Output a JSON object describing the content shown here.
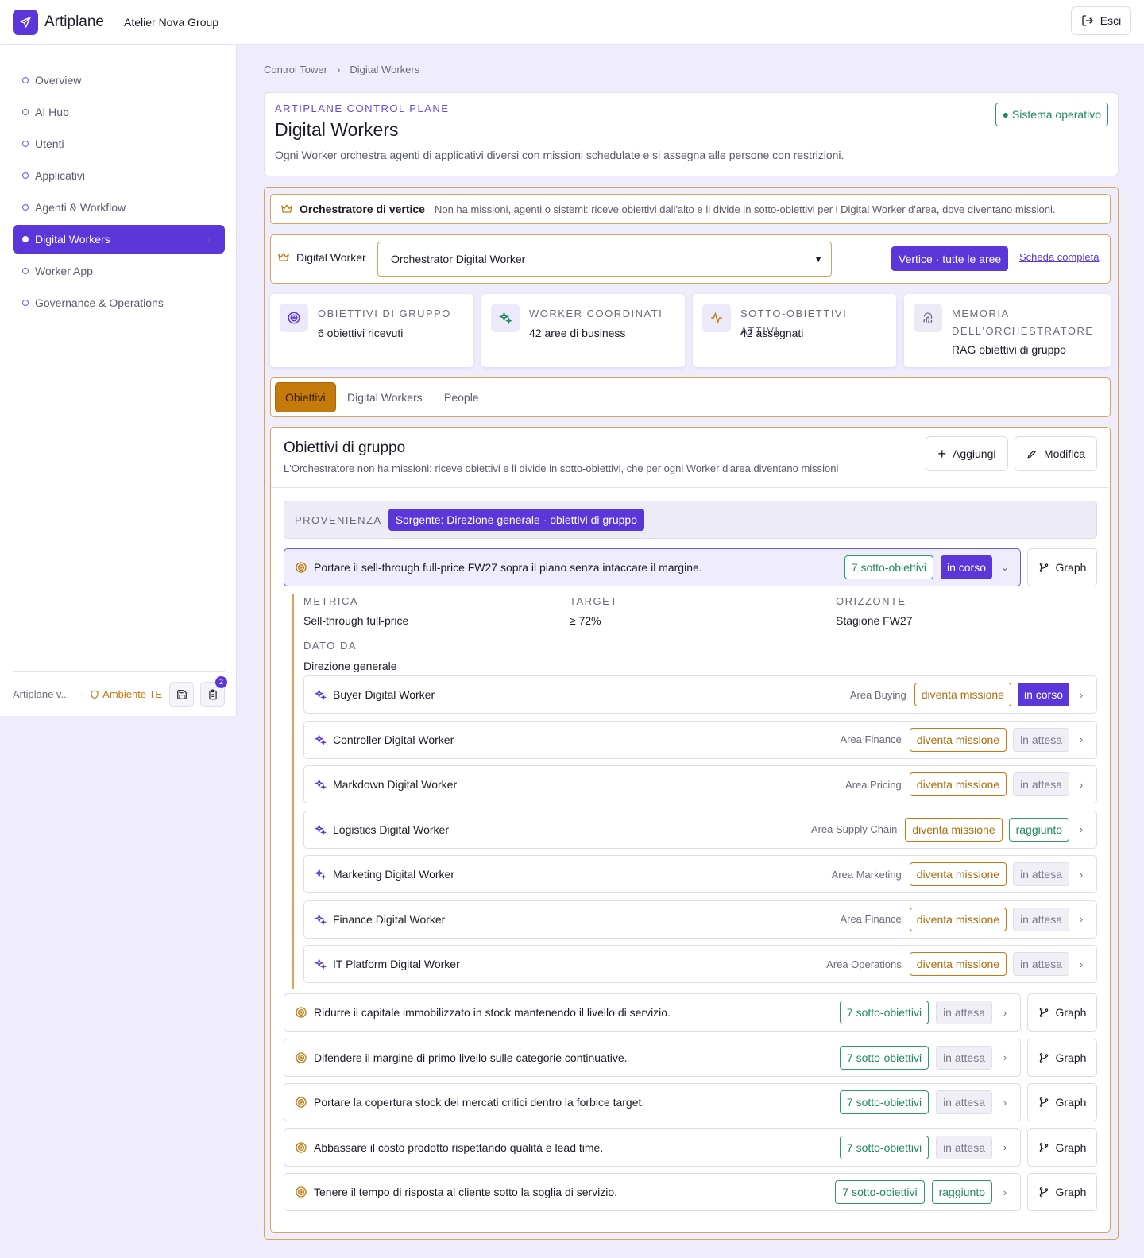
{
  "header": {
    "brand": "Artiplane",
    "org": "Atelier Nova Group",
    "exit_label": "Esci"
  },
  "sidebar": {
    "items": [
      {
        "label": "Overview",
        "active": false
      },
      {
        "label": "AI Hub",
        "active": false
      },
      {
        "label": "Utenti",
        "active": false
      },
      {
        "label": "Applicativi",
        "active": false
      },
      {
        "label": "Agenti & Workflow",
        "active": false
      },
      {
        "label": "Digital Workers",
        "active": true
      },
      {
        "label": "Worker App",
        "active": false
      },
      {
        "label": "Governance & Operations",
        "active": false
      }
    ],
    "footer": {
      "version": "Artiplane v...",
      "env": "Ambiente TE",
      "badge_count": "2"
    }
  },
  "breadcrumb": [
    "Control Tower",
    "Digital Workers"
  ],
  "hero": {
    "eyebrow": "ARTIPLANE CONTROL PLANE",
    "title": "Digital Workers",
    "subtitle": "Ogni Worker orchestra agenti di applicativi diversi con missioni schedulate e si assegna alle persone con restrizioni.",
    "status": "● Sistema operativo"
  },
  "orchestrator": {
    "title": "Orchestratore di vertice",
    "description": "Non ha missioni, agenti o sistemi: riceve obiettivi dall'alto e li divide in sotto-obiettivi per i Digital Worker d'area, dove diventano missioni."
  },
  "worker_select": {
    "label": "Digital Worker",
    "value": "Orchestrator Digital Worker",
    "vertex_button": "Vertice · tutte le aree",
    "full_card_link": "Scheda completa"
  },
  "kpis": [
    {
      "label": "OBIETTIVI DI GRUPPO",
      "value": "6 obiettivi ricevuti",
      "icon": "target-icon"
    },
    {
      "label": "WORKER COORDINATI",
      "value": "42 aree di business",
      "icon": "sparkle-icon"
    },
    {
      "label": "SOTTO-OBIETTIVI ATTIVI",
      "value": "42 assegnati",
      "icon": "activity-icon"
    },
    {
      "label": "MEMORIA DELL'ORCHESTRATORE",
      "value": "RAG obiettivi di gruppo",
      "icon": "fingerprint-icon"
    }
  ],
  "tabs": [
    "Obiettivi",
    "Digital Workers",
    "People"
  ],
  "panel": {
    "title": "Obiettivi di gruppo",
    "subtitle": "L'Orchestratore non ha missioni: riceve obiettivi e li divide in sotto-obiettivi, che per ogni Worker d'area diventano missioni",
    "add_label": "Aggiungi",
    "edit_label": "Modifica",
    "provenance_label": "PROVENIENZA",
    "provenance_value": "Sorgente: Direzione generale · obiettivi di gruppo",
    "graph_label": "Graph",
    "expanded_goal": {
      "text": "Portare il sell-through full-price FW27 sopra il piano senza intaccare il margine.",
      "sub_count": "7 sotto-obiettivi",
      "status": "in corso",
      "metric_label": "METRICA",
      "metric_value": "Sell-through full-price",
      "target_label": "TARGET",
      "target_value": "≥ 72%",
      "horizon_label": "ORIZZONTE",
      "horizon_value": "Stagione FW27",
      "given_by_label": "DATO DA",
      "given_by_value": "Direzione generale",
      "mission_label": "diventa missione",
      "sub_goals": [
        {
          "name": "Buyer Digital Worker",
          "area": "Area Buying",
          "status": "in corso",
          "kind": "purple"
        },
        {
          "name": "Controller Digital Worker",
          "area": "Area Finance",
          "status": "in attesa",
          "kind": "grey"
        },
        {
          "name": "Markdown Digital Worker",
          "area": "Area Pricing",
          "status": "in attesa",
          "kind": "grey"
        },
        {
          "name": "Logistics Digital Worker",
          "area": "Area Supply Chain",
          "status": "raggiunto",
          "kind": "green"
        },
        {
          "name": "Marketing Digital Worker",
          "area": "Area Marketing",
          "status": "in attesa",
          "kind": "grey"
        },
        {
          "name": "Finance Digital Worker",
          "area": "Area Finance",
          "status": "in attesa",
          "kind": "grey"
        },
        {
          "name": "IT Platform Digital Worker",
          "area": "Area Operations",
          "status": "in attesa",
          "kind": "grey"
        }
      ]
    },
    "goals": [
      {
        "text": "Ridurre il capitale immobilizzato in stock mantenendo il livello di servizio.",
        "sub_count": "7 sotto-obiettivi",
        "status": "in attesa",
        "kind": "grey"
      },
      {
        "text": "Difendere il margine di primo livello sulle categorie continuative.",
        "sub_count": "7 sotto-obiettivi",
        "status": "in attesa",
        "kind": "grey"
      },
      {
        "text": "Portare la copertura stock dei mercati critici dentro la forbice target.",
        "sub_count": "7 sotto-obiettivi",
        "status": "in attesa",
        "kind": "grey"
      },
      {
        "text": "Abbassare il costo prodotto rispettando qualità e lead time.",
        "sub_count": "7 sotto-obiettivi",
        "status": "in attesa",
        "kind": "grey"
      },
      {
        "text": "Tenere il tempo di risposta al cliente sotto la soglia di servizio.",
        "sub_count": "7 sotto-obiettivi",
        "status": "raggiunto",
        "kind": "green"
      }
    ]
  }
}
